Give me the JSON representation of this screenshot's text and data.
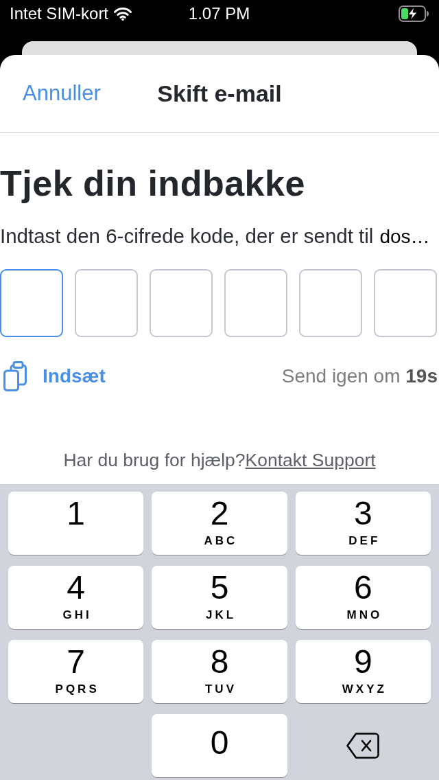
{
  "status_bar": {
    "carrier": "Intet SIM-kort",
    "time": "1.07 PM"
  },
  "nav": {
    "cancel": "Annuller",
    "title": "Skift e-mail"
  },
  "heading": "Tjek din indbakke",
  "instruction": {
    "text": "Indtast den 6-cifrede kode, der er sendt til",
    "email": "dos…"
  },
  "code_boxes": [
    {
      "selected": true
    },
    {
      "selected": false
    },
    {
      "selected": false
    },
    {
      "selected": false
    },
    {
      "selected": false
    },
    {
      "selected": false
    }
  ],
  "paste_button": {
    "label": "Indsæt"
  },
  "resend": "Send igen om **19s**",
  "help": {
    "text": "Har du brug for hjælp?",
    "link": "Kontakt Support"
  },
  "keypad": {
    "rows": [
      [
        {
          "kind": "digit",
          "digit": "1"
        },
        {
          "kind": "digit",
          "digit": "2",
          "letters": "ABC"
        },
        {
          "kind": "digit",
          "digit": "3",
          "letters": "DEF"
        }
      ],
      [
        {
          "kind": "digit",
          "digit": "4",
          "letters": "GHI"
        },
        {
          "kind": "digit",
          "digit": "5",
          "letters": "JKL"
        },
        {
          "kind": "digit",
          "digit": "6",
          "letters": "MNO"
        }
      ],
      [
        {
          "kind": "digit",
          "digit": "7",
          "letters": "PQRS"
        },
        {
          "kind": "digit",
          "digit": "8",
          "letters": "TUV"
        },
        {
          "kind": "digit",
          "digit": "9",
          "letters": "WXYZ"
        }
      ],
      [
        {
          "kind": "empty"
        },
        {
          "kind": "digit",
          "digit": "0"
        },
        {
          "kind": "delete"
        }
      ]
    ]
  }
}
